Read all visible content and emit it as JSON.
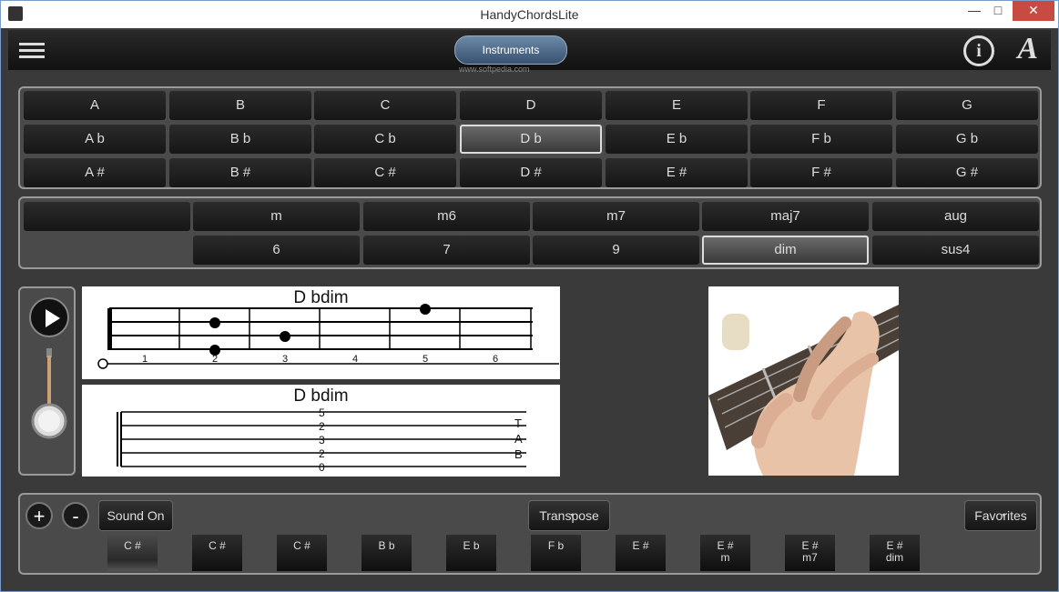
{
  "window": {
    "title": "HandyChordsLite",
    "min": "—",
    "max": "□",
    "close": "✕"
  },
  "toolbar": {
    "instruments_label": "Instruments",
    "watermark": "www.softpedia.com",
    "info_glyph": "i",
    "font_glyph": "A"
  },
  "keys": [
    [
      "A",
      "B",
      "C",
      "D",
      "E",
      "F",
      "G"
    ],
    [
      "A b",
      "B b",
      "C b",
      "D b",
      "E b",
      "F b",
      "G b"
    ],
    [
      "A #",
      "B #",
      "C #",
      "D #",
      "E #",
      "F #",
      "G #"
    ]
  ],
  "selected_key": "D b",
  "chord_types": [
    [
      "m",
      "m6",
      "m7",
      "maj7",
      "aug"
    ],
    [
      "6",
      "7",
      "9",
      "dim",
      "sus4"
    ]
  ],
  "selected_type": "dim",
  "fret_diagram": {
    "title": "D bdim",
    "frets": [
      "1",
      "2",
      "3",
      "4",
      "5",
      "6"
    ]
  },
  "tab_diagram": {
    "title": "D bdim",
    "numbers": [
      "5",
      "2",
      "3",
      "2",
      "0"
    ],
    "tab_letters": [
      "T",
      "A",
      "B"
    ]
  },
  "bottom": {
    "plus": "+",
    "minus": "-",
    "sound_label": "Sound On",
    "transpose_label": "Transpose",
    "favorites_label": "Favorites",
    "history": [
      {
        "root": "C #",
        "type": ""
      },
      {
        "root": "C #",
        "type": ""
      },
      {
        "root": "C #",
        "type": ""
      },
      {
        "root": "B b",
        "type": ""
      },
      {
        "root": "E b",
        "type": ""
      },
      {
        "root": "F b",
        "type": ""
      },
      {
        "root": "E #",
        "type": ""
      },
      {
        "root": "E #",
        "type": "m"
      },
      {
        "root": "E #",
        "type": "m7"
      },
      {
        "root": "E #",
        "type": "dim"
      }
    ]
  },
  "colors": {
    "selected_border": "#dddddd",
    "close_button": "#c74b41",
    "instrument_button": "#4f6b8b"
  }
}
